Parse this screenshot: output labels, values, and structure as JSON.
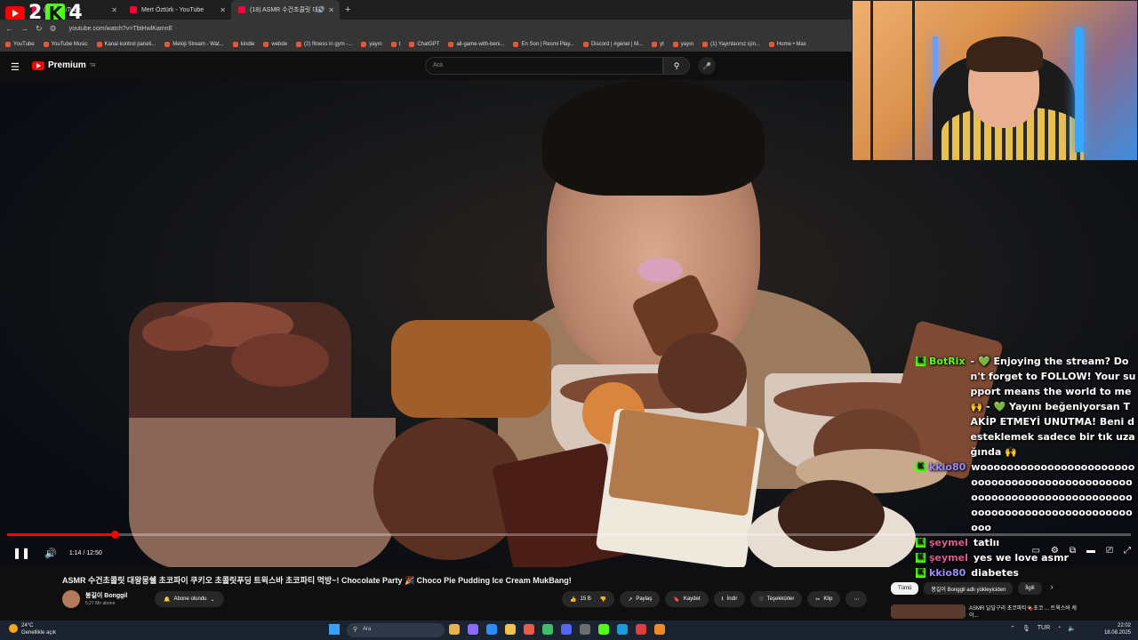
{
  "browser": {
    "tabs": [
      {
        "label": "(18) YouTube",
        "active": false
      },
      {
        "label": "Mert Öztürk - YouTube",
        "active": false
      },
      {
        "label": "(18) ASMR 수건초콜릿 대왕",
        "active": true
      }
    ],
    "url": "youtube.com/watch?v=TbtHwlKamnE",
    "bookmarks": [
      "YouTube",
      "YouTube Music",
      "Kanal kontrol paneli...",
      "Meloji Stream - Wat...",
      "kindle",
      "webde",
      "(2) fitness in gym -...",
      "yayın",
      "t",
      "ChatGPT",
      "all-game-with-beni...",
      "En Son | Resmi Play...",
      "Discord | #genel | M...",
      "yt",
      "yayın",
      "(1) Yayınlarınız için...",
      "Home • Max"
    ]
  },
  "overlay": {
    "counter_left": "2",
    "counter_right": "4"
  },
  "youtube": {
    "logo": "Premium",
    "logo_sup": "TR",
    "search_placeholder": "Ara"
  },
  "player": {
    "time": "1:14 / 12:50",
    "progress": 0.096
  },
  "chat": [
    {
      "user": "BotRix",
      "color": "#53fc18",
      "prefix": "- 💚",
      "message": "Enjoying the stream? Don't forget to FOLLOW! Your support means the world to me 🙌 - 💚 Yayını beğeniyorsan TAKİP ETMEYİ UNUTMA! Beni desteklemek sadece bir tık uzağında 🙌"
    },
    {
      "user": "kkio80",
      "color": "#9b8cff",
      "prefix": "",
      "message": "woooooooooooooooooooooooooooooooooooooooooooooooooooooooooooooooooooooooooooooooooooooooooooooooooo"
    },
    {
      "user": "şeymel",
      "color": "#e05a8a",
      "prefix": "",
      "message": "tatlıı"
    },
    {
      "user": "şeymel",
      "color": "#e05a8a",
      "prefix": "",
      "message": "yes we love asmr"
    },
    {
      "user": "kkio80",
      "color": "#9b8cff",
      "prefix": "",
      "message": "diabetes"
    }
  ],
  "video": {
    "title": "ASMR 수건초콜릿 대왕몽쉘 초코파이 쿠키오 초콜릿푸딩 트윅스바 초코파티 먹방~! Chocolate Party 🎉 Choco Pie Pudding Ice Cream MukBang!",
    "channel": "봉길이 Bonggil",
    "subscribers": "5,27 Mn abone",
    "subscribe_label": "Abone olundu",
    "likes": "15 B",
    "share": "Paylaş",
    "save": "Kaydet",
    "download": "İndir",
    "thanks": "Teşekkürler",
    "clip": "Klip"
  },
  "recs": {
    "chips": [
      "Tümü",
      "봉길이 Bonggil adlı yükleyiciden",
      "İlgili"
    ],
    "first_title": "ASMR 달달구리 초코파티🍫초코 ... 트윅스바 케이..."
  },
  "taskbar": {
    "weather_temp": "24°C",
    "weather_desc": "Genellikle açık",
    "search": "Ara",
    "lang": "TUR",
    "time": "22:02",
    "date": "18.08.2025"
  }
}
